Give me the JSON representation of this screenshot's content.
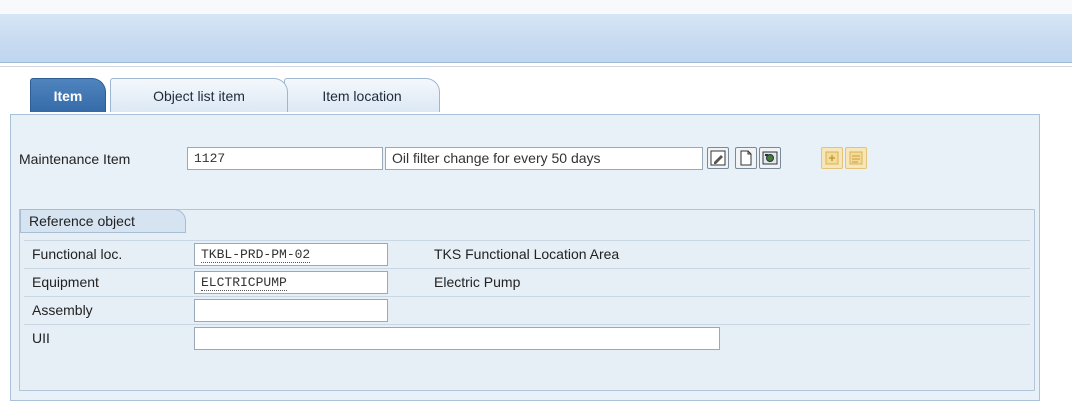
{
  "tabs": [
    {
      "label": "Item",
      "active": true
    },
    {
      "label": "Object list item",
      "active": false
    },
    {
      "label": "Item location",
      "active": false
    }
  ],
  "maintenance_item": {
    "label": "Maintenance Item",
    "value": "1127",
    "description": "Oil filter change for every 50 days"
  },
  "toolbar_icons": [
    "edit-long-text-icon",
    "create-document-icon",
    "display-object-icon",
    "item-action-icon-1",
    "item-action-icon-2"
  ],
  "reference_object": {
    "title": "Reference object",
    "functional_loc": {
      "label": "Functional loc.",
      "value": "TKBL-PRD-PM-02",
      "description": "TKS Functional Location Area"
    },
    "equipment": {
      "label": "Equipment",
      "value": "ELCTRICPUMP",
      "description": "Electric Pump"
    },
    "assembly": {
      "label": "Assembly",
      "value": ""
    },
    "uii": {
      "label": "UII",
      "value": ""
    }
  },
  "colors": {
    "active_tab": "#356ba8",
    "panel_bg": "#e8f1f8",
    "titlebar": "#c9dcf1"
  }
}
